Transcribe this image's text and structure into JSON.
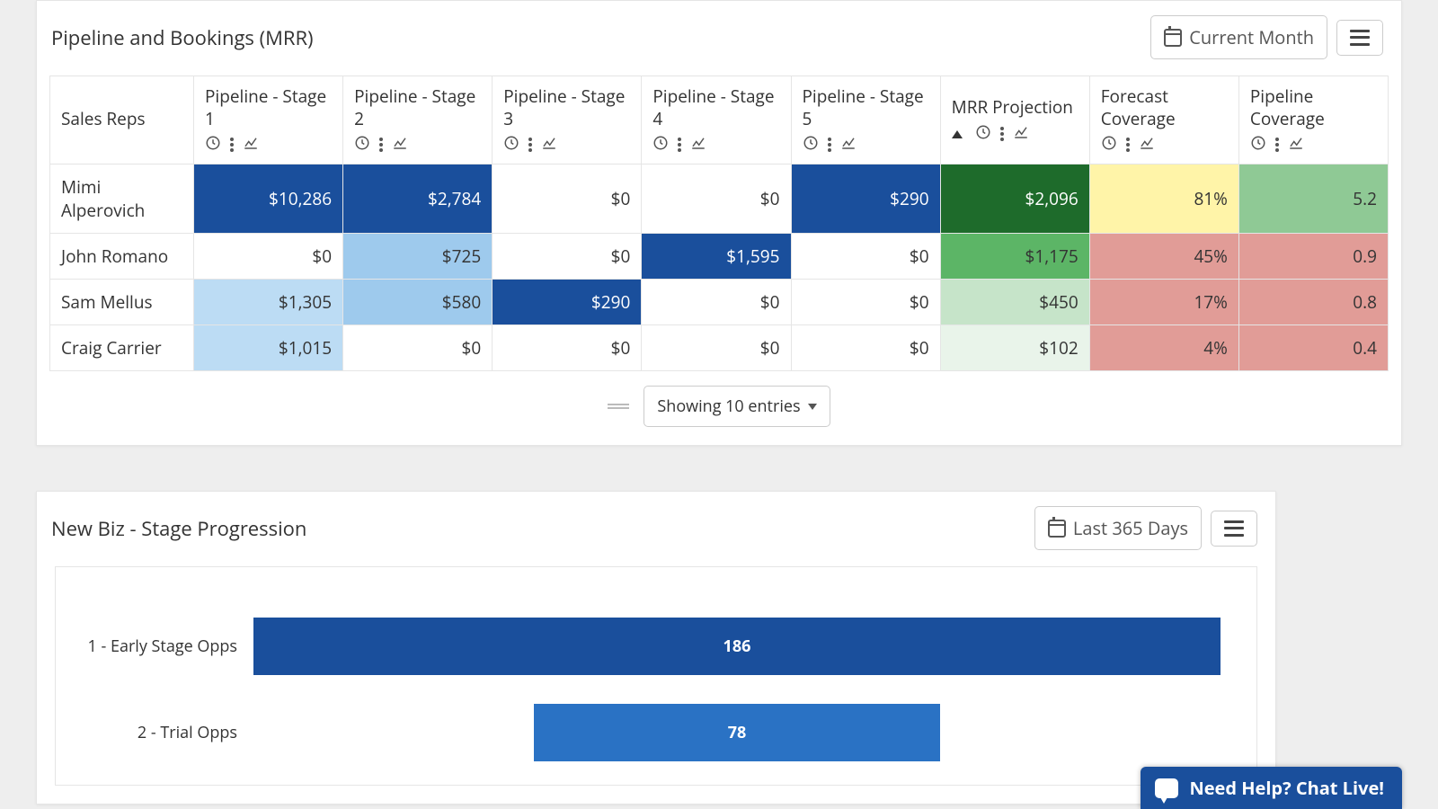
{
  "card1": {
    "title": "Pipeline and Bookings (MRR)",
    "date_btn": "Current Month",
    "entries_dd": "Showing 10 entries",
    "columns": [
      "Sales Reps",
      "Pipeline - Stage 1",
      "Pipeline - Stage 2",
      "Pipeline - Stage 3",
      "Pipeline - Stage 4",
      "Pipeline - Stage 5",
      "MRR Projection",
      "Forecast Coverage",
      "Pipeline Coverage"
    ],
    "rows": [
      {
        "name": "Mimi Alperovich",
        "cells": [
          {
            "v": "$10,286",
            "c": "bg-blue-dark"
          },
          {
            "v": "$2,784",
            "c": "bg-blue-dark"
          },
          {
            "v": "$0",
            "c": ""
          },
          {
            "v": "$0",
            "c": ""
          },
          {
            "v": "$290",
            "c": "bg-blue-dark"
          },
          {
            "v": "$2,096",
            "c": "bg-green-dark"
          },
          {
            "v": "81%",
            "c": "bg-yellow"
          },
          {
            "v": "5.2",
            "c": "bg-greenish"
          }
        ]
      },
      {
        "name": "John Romano",
        "cells": [
          {
            "v": "$0",
            "c": ""
          },
          {
            "v": "$725",
            "c": "bg-blue-med"
          },
          {
            "v": "$0",
            "c": ""
          },
          {
            "v": "$1,595",
            "c": "bg-blue-dark"
          },
          {
            "v": "$0",
            "c": ""
          },
          {
            "v": "$1,175",
            "c": "bg-green-med"
          },
          {
            "v": "45%",
            "c": "bg-red"
          },
          {
            "v": "0.9",
            "c": "bg-red"
          }
        ]
      },
      {
        "name": "Sam Mellus",
        "cells": [
          {
            "v": "$1,305",
            "c": "bg-blue-light"
          },
          {
            "v": "$580",
            "c": "bg-blue-med"
          },
          {
            "v": "$290",
            "c": "bg-blue-dark"
          },
          {
            "v": "$0",
            "c": ""
          },
          {
            "v": "$0",
            "c": ""
          },
          {
            "v": "$450",
            "c": "bg-green-lite"
          },
          {
            "v": "17%",
            "c": "bg-red"
          },
          {
            "v": "0.8",
            "c": "bg-red"
          }
        ]
      },
      {
        "name": "Craig Carrier",
        "cells": [
          {
            "v": "$1,015",
            "c": "bg-blue-light"
          },
          {
            "v": "$0",
            "c": ""
          },
          {
            "v": "$0",
            "c": ""
          },
          {
            "v": "$0",
            "c": ""
          },
          {
            "v": "$0",
            "c": ""
          },
          {
            "v": "$102",
            "c": "bg-green-vlite"
          },
          {
            "v": "4%",
            "c": "bg-red"
          },
          {
            "v": "0.4",
            "c": "bg-red"
          }
        ]
      }
    ]
  },
  "card2": {
    "title": "New Biz - Stage Progression",
    "date_btn": "Last 365 Days"
  },
  "chart_data": {
    "type": "bar",
    "orientation": "horizontal",
    "title": "New Biz - Stage Progression",
    "categories": [
      "1 - Early Stage Opps",
      "2 - Trial Opps"
    ],
    "values": [
      186,
      78
    ],
    "xlim": [
      0,
      186
    ],
    "series_color": [
      "#1a4f9c",
      "#2a72c4"
    ]
  },
  "chat": {
    "label": "Need Help? Chat Live!"
  }
}
